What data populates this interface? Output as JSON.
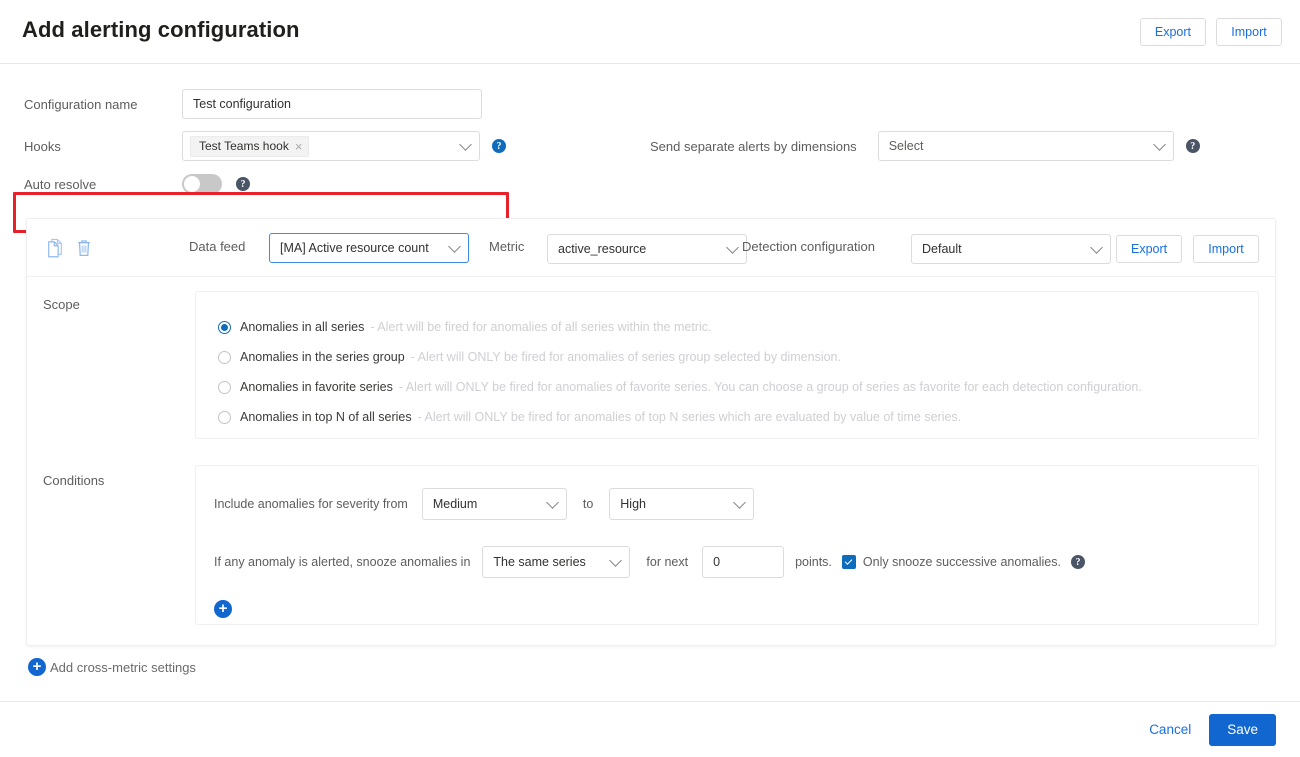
{
  "header": {
    "title": "Add alerting configuration",
    "export_label": "Export",
    "import_label": "Import"
  },
  "form": {
    "configuration_name": {
      "label": "Configuration name",
      "value": "Test configuration"
    },
    "hooks": {
      "label": "Hooks",
      "chip": "Test Teams hook",
      "chip_remove": "×",
      "help": "?"
    },
    "auto_resolve": {
      "label": "Auto resolve",
      "state": "off",
      "help": "?"
    },
    "send_separate_alerts": {
      "label": "Send separate alerts by dimensions",
      "value": "Select",
      "help": "?"
    }
  },
  "metric_card": {
    "data_feed": {
      "label": "Data feed",
      "value": "[MA] Active resource count"
    },
    "metric": {
      "label": "Metric",
      "value": "active_resource"
    },
    "detection_configuration": {
      "label": "Detection configuration",
      "value": "Default",
      "export_label": "Export",
      "import_label": "Import"
    },
    "scope": {
      "label": "Scope",
      "options": [
        {
          "label": "Anomalies in all series",
          "description": "- Alert will be fired for anomalies of all series within the metric.",
          "selected": true
        },
        {
          "label": "Anomalies in the series group",
          "description": "- Alert will ONLY be fired for anomalies of series group selected by dimension.",
          "selected": false
        },
        {
          "label": "Anomalies in favorite series",
          "description": "- Alert will ONLY be fired for anomalies of favorite series. You can choose a group of series as favorite for each detection configuration.",
          "selected": false
        },
        {
          "label": "Anomalies in top N of all series",
          "description": "- Alert will ONLY be fired for anomalies of top N series which are evaluated by value of time series.",
          "selected": false
        }
      ]
    },
    "conditions": {
      "label": "Conditions",
      "severity_prefix": "Include anomalies for severity from",
      "severity_from": "Medium",
      "severity_to_word": "to",
      "severity_to": "High",
      "snooze_prefix": "If any anomaly is alerted, snooze anomalies in",
      "snooze_scope": "The same series",
      "for_next": "for next",
      "points_value": "0",
      "points_suffix": "points.",
      "only_snooze_label": "Only snooze successive anomalies.",
      "only_snooze_checked": true,
      "help": "?",
      "add_condition": "+"
    }
  },
  "add_cross_metric": {
    "icon": "+",
    "label": "Add cross-metric settings"
  },
  "footer": {
    "cancel_label": "Cancel",
    "save_label": "Save"
  },
  "colors": {
    "accent": "#1266cf",
    "link": "#1a6fe0",
    "highlight": "#e8202a",
    "muted_desc": "#cfcfd4"
  }
}
